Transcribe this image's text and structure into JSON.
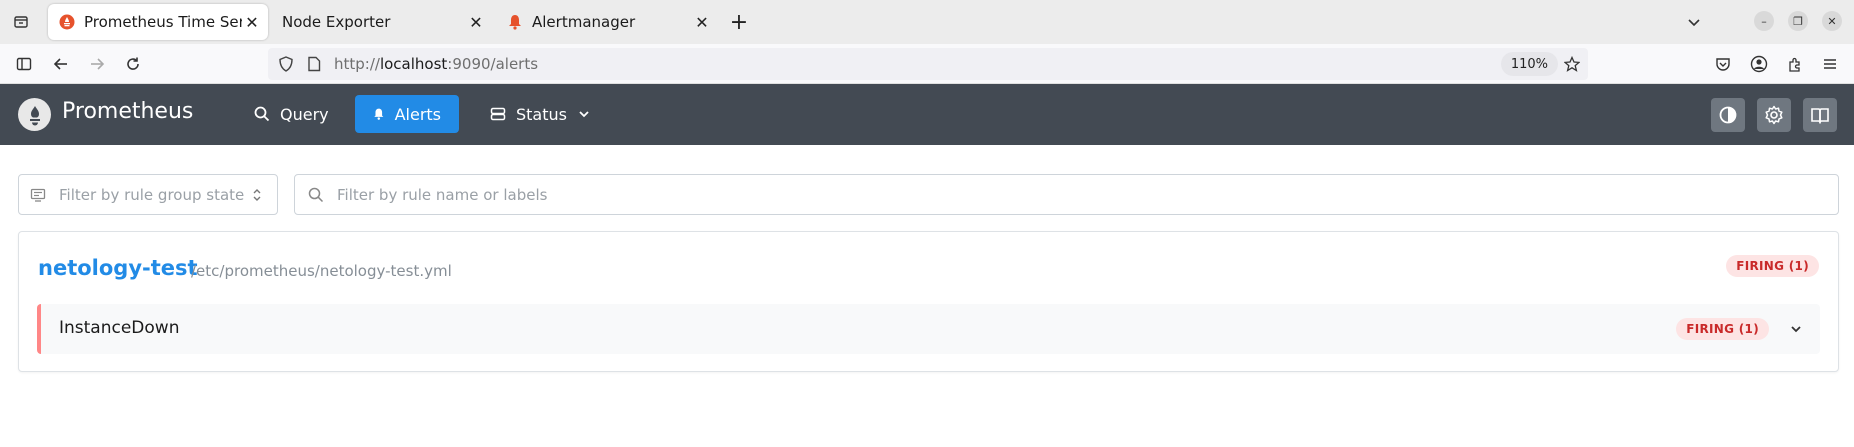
{
  "browser": {
    "tabs": [
      {
        "title": "Prometheus Time Series C",
        "active": true,
        "favicon": "prometheus-favicon"
      },
      {
        "title": "Node Exporter",
        "active": false,
        "favicon": "none"
      },
      {
        "title": "Alertmanager",
        "active": false,
        "favicon": "alertmanager-favicon"
      }
    ],
    "url_prefix": "http://",
    "url_host": "localhost",
    "url_rest": ":9090/alerts",
    "zoom": "110%"
  },
  "app": {
    "brand": "Prometheus",
    "nav": {
      "query": "Query",
      "alerts": "Alerts",
      "status": "Status"
    },
    "accent_color": "#228be6",
    "header_color": "#434a53"
  },
  "filters": {
    "state_placeholder": "Filter by rule group state",
    "search_placeholder": "Filter by rule name or labels"
  },
  "rule_group": {
    "name": "netology-test",
    "file": "/etc/prometheus/netology-test.yml",
    "badge": "FIRING (1)",
    "rules": [
      {
        "name": "InstanceDown",
        "badge": "FIRING (1)",
        "state": "firing"
      }
    ]
  }
}
